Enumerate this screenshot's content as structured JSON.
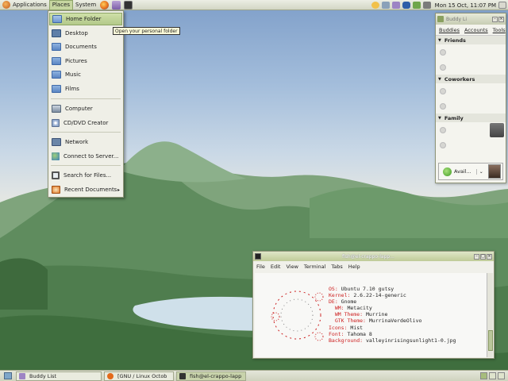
{
  "top_panel": {
    "menus": [
      "Applications",
      "Places",
      "System"
    ],
    "clock": "Mon 15 Oct, 11:07 PM"
  },
  "places_menu": {
    "items": [
      {
        "label": "Home Folder",
        "icon": "home-folder-icon"
      },
      {
        "label": "Desktop",
        "icon": "desktop-icon"
      },
      {
        "label": "Documents",
        "icon": "folder-icon"
      },
      {
        "label": "Pictures",
        "icon": "folder-icon"
      },
      {
        "label": "Music",
        "icon": "folder-icon"
      },
      {
        "label": "Films",
        "icon": "folder-icon"
      },
      {
        "label": "Computer",
        "icon": "computer-icon"
      },
      {
        "label": "CD/DVD Creator",
        "icon": "cd-icon"
      },
      {
        "label": "Network",
        "icon": "network-icon"
      },
      {
        "label": "Connect to Server...",
        "icon": "globe-icon"
      },
      {
        "label": "Search for Files...",
        "icon": "search-icon"
      },
      {
        "label": "Recent Documents",
        "icon": "recent-icon"
      }
    ],
    "tooltip": "Open your personal folder"
  },
  "buddy_list": {
    "title": "Buddy Li",
    "menus": [
      "Buddies",
      "Accounts",
      "Tools"
    ],
    "groups": [
      "Friends",
      "Coworkers",
      "Family"
    ],
    "status": "Avail..."
  },
  "terminal": {
    "title": "fish@el-crappo-lapp...",
    "menus": [
      "File",
      "Edit",
      "View",
      "Terminal",
      "Tabs",
      "Help"
    ],
    "lines": [
      {
        "k": "OS: ",
        "v": "Ubuntu 7.10 gutsy"
      },
      {
        "k": "Kernel: ",
        "v": "2.6.22-14-generic"
      },
      {
        "k": "DE: ",
        "v": "Gnome"
      },
      {
        "k": "  WM: ",
        "v": "Metacity"
      },
      {
        "k": "  WM Theme: ",
        "v": "Murrine"
      },
      {
        "k": "  GTK Theme: ",
        "v": "MurrinaVerdeOlivo"
      },
      {
        "k": "Icons: ",
        "v": "Mist"
      },
      {
        "k": "Font: ",
        "v": "Tahoma 8"
      },
      {
        "k": "Background: ",
        "v": "valleyinrisingsunlight1-0.jpg"
      }
    ]
  },
  "bottom_panel": {
    "tasks": [
      "Buddy List",
      "[GNU / Linux Octob",
      "fish@el-crappo-lapp"
    ]
  },
  "colors": {
    "accent": "#b3c98a",
    "term_key": "#cc1e1e"
  }
}
